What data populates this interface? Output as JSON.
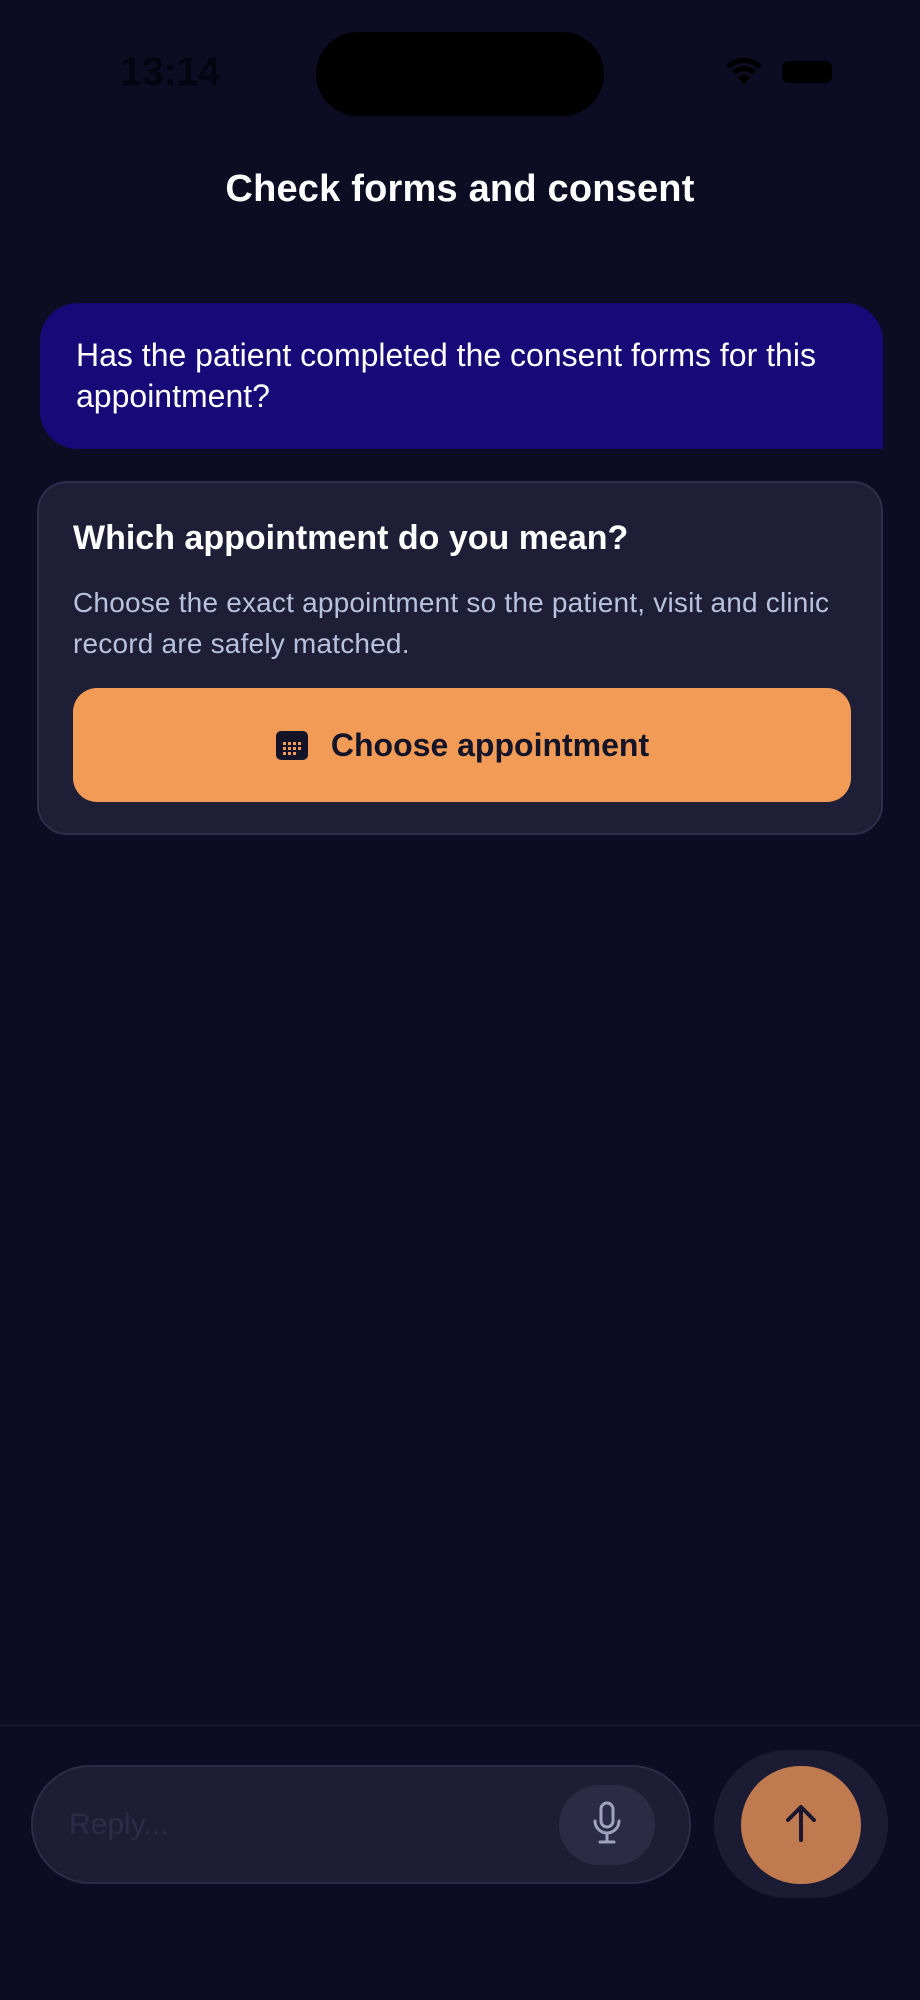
{
  "status_bar": {
    "time": "13:14"
  },
  "header": {
    "title": "Check forms and consent"
  },
  "conversation": {
    "user_message": "Has the patient completed the consent forms for this appointment?",
    "clarify_card": {
      "title": "Which appointment do you mean?",
      "description": "Choose the exact appointment so the patient, visit and clinic record are safely matched.",
      "button_label": "Choose appointment",
      "button_icon": "calendar-icon"
    }
  },
  "composer": {
    "placeholder": "Reply...",
    "mic_icon": "microphone-icon",
    "send_icon": "arrow-up-icon"
  },
  "colors": {
    "background": "#0c0c23",
    "user_bubble": "#170a78",
    "card": "#1e1e36",
    "accent": "#f29b56",
    "send_button": "#c07a50"
  }
}
